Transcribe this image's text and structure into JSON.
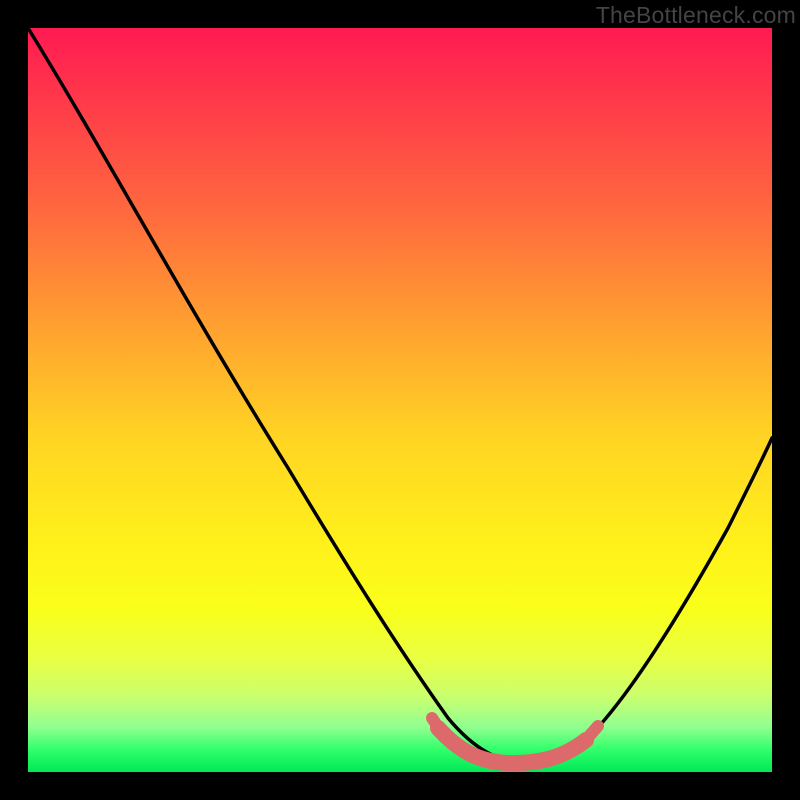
{
  "watermark": "TheBottleneck.com",
  "colors": {
    "page_bg": "#000000",
    "gradient_top": "#ff1a52",
    "gradient_bottom": "#00e858",
    "curve_stroke": "#000000",
    "band_stroke": "#dd6a6a"
  },
  "chart_data": {
    "type": "line",
    "title": "",
    "xlabel": "",
    "ylabel": "",
    "xlim": [
      0,
      100
    ],
    "ylim": [
      0,
      100
    ],
    "series": [
      {
        "name": "curve",
        "x": [
          0,
          5,
          10,
          15,
          20,
          25,
          30,
          35,
          40,
          45,
          50,
          55,
          58,
          60,
          62,
          65,
          68,
          70,
          73,
          76,
          80,
          85,
          90,
          95,
          100
        ],
        "y": [
          100,
          92,
          84,
          76,
          68,
          60,
          52,
          44,
          36,
          28,
          20,
          12,
          7,
          5,
          4,
          3,
          3,
          3,
          4,
          6,
          10,
          18,
          28,
          40,
          52
        ]
      }
    ],
    "highlight_band": {
      "x_start": 56,
      "x_end": 75,
      "y_approx": 3
    },
    "grid": false,
    "legend": false
  }
}
